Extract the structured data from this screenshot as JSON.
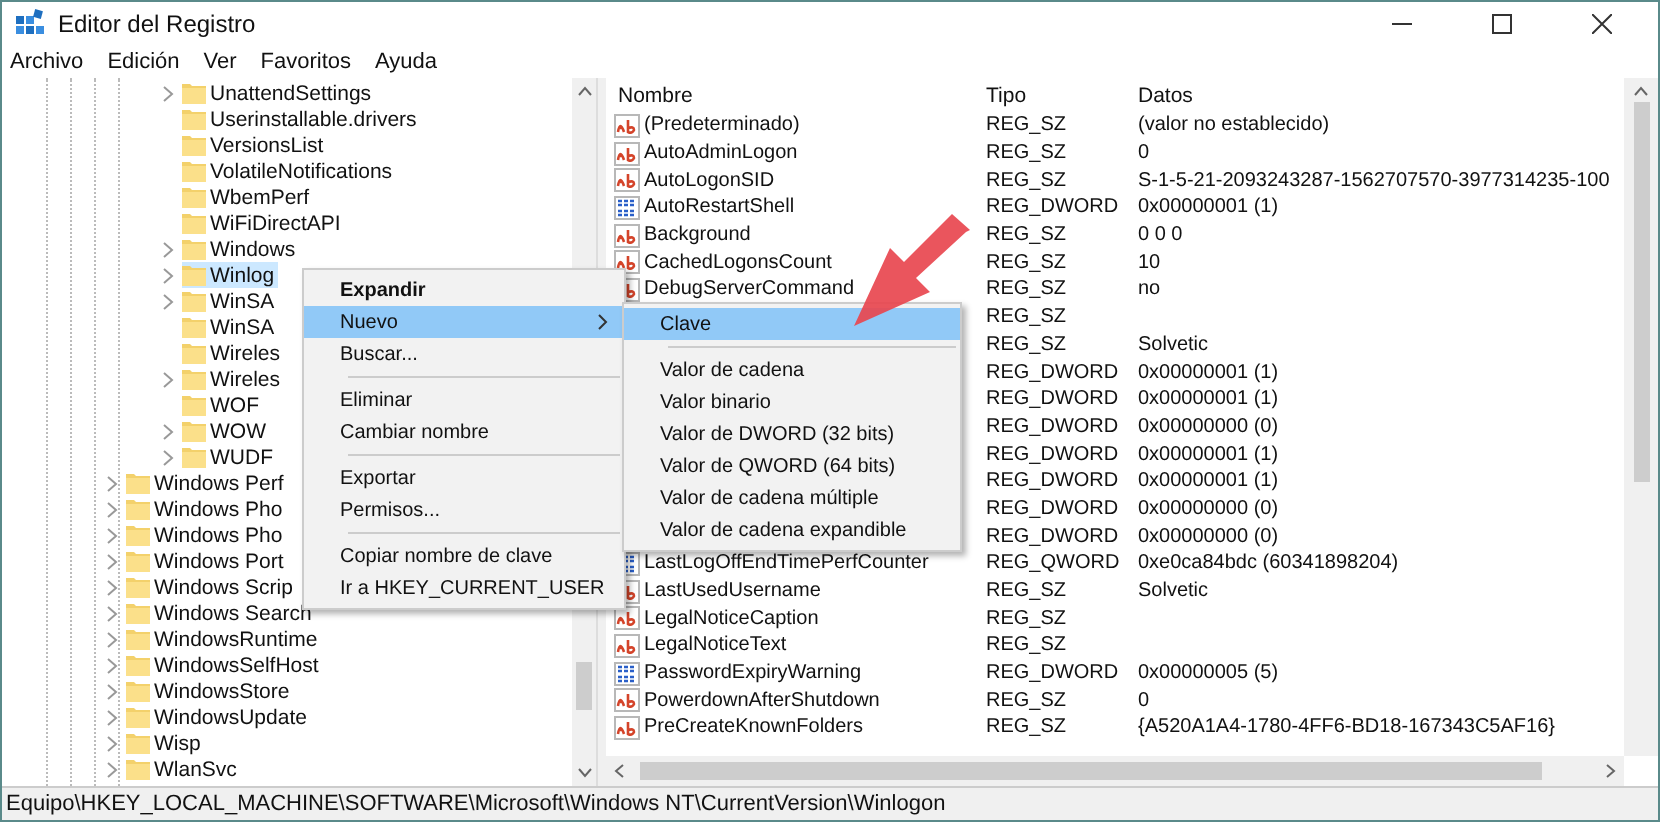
{
  "window": {
    "title": "Editor del Registro"
  },
  "menu": [
    "Archivo",
    "Edición",
    "Ver",
    "Favoritos",
    "Ayuda"
  ],
  "tree": {
    "items": [
      {
        "children": [
          {
            "label": "UnattendSettings",
            "expandable": true,
            "selected": false
          },
          {
            "label": "Userinstallable.drivers",
            "expandable": false,
            "selected": false
          },
          {
            "label": "VersionsList",
            "expandable": false,
            "selected": false
          },
          {
            "label": "VolatileNotifications",
            "expandable": false,
            "selected": false
          },
          {
            "label": "WbemPerf",
            "expandable": false,
            "selected": false
          },
          {
            "label": "WiFiDirectAPI",
            "expandable": false,
            "selected": false
          },
          {
            "label": "Windows",
            "expandable": true,
            "selected": false
          },
          {
            "label": "Winlog",
            "expandable": true,
            "selected": true
          },
          {
            "label": "WinSA",
            "expandable": true,
            "selected": false
          },
          {
            "label": "WinSA",
            "expandable": false,
            "selected": false
          },
          {
            "label": "Wireles",
            "expandable": false,
            "selected": false
          },
          {
            "label": "Wireles",
            "expandable": true,
            "selected": false
          },
          {
            "label": "WOF",
            "expandable": false,
            "selected": false
          },
          {
            "label": "WOW",
            "expandable": true,
            "selected": false
          },
          {
            "label": "WUDF",
            "expandable": true,
            "selected": false
          }
        ]
      },
      {
        "label": "Windows Perf",
        "expandable": true,
        "selected": false
      },
      {
        "label": "Windows Pho",
        "expandable": true,
        "selected": false
      },
      {
        "label": "Windows Pho",
        "expandable": true,
        "selected": false
      },
      {
        "label": "Windows Port",
        "expandable": true,
        "selected": false
      },
      {
        "label": "Windows Scrip",
        "expandable": true,
        "selected": false
      },
      {
        "label": "Windows Search",
        "expandable": true,
        "selected": false
      },
      {
        "label": "WindowsRuntime",
        "expandable": true,
        "selected": false
      },
      {
        "label": "WindowsSelfHost",
        "expandable": true,
        "selected": false
      },
      {
        "label": "WindowsStore",
        "expandable": true,
        "selected": false
      },
      {
        "label": "WindowsUpdate",
        "expandable": true,
        "selected": false
      },
      {
        "label": "Wisp",
        "expandable": true,
        "selected": false
      },
      {
        "label": "WlanSvc",
        "expandable": true,
        "selected": false
      }
    ]
  },
  "values": {
    "columns": [
      "Nombre",
      "Tipo",
      "Datos"
    ],
    "rows": [
      {
        "kind": "string",
        "name": "(Predeterminado)",
        "type": "REG_SZ",
        "data": "(valor no establecido)"
      },
      {
        "kind": "string",
        "name": "AutoAdminLogon",
        "type": "REG_SZ",
        "data": "0"
      },
      {
        "kind": "string",
        "name": "AutoLogonSID",
        "type": "REG_SZ",
        "data": "S-1-5-21-2093243287-1562707570-3977314235-100"
      },
      {
        "kind": "binary",
        "name": "AutoRestartShell",
        "type": "REG_DWORD",
        "data": "0x00000001 (1)"
      },
      {
        "kind": "string",
        "name": "Background",
        "type": "REG_SZ",
        "data": "0 0 0"
      },
      {
        "kind": "string",
        "name": "CachedLogonsCount",
        "type": "REG_SZ",
        "data": "10"
      },
      {
        "kind": "string",
        "name": "DebugServerCommand",
        "type": "REG_SZ",
        "data": "no"
      },
      {
        "type": "REG_SZ"
      },
      {
        "type": "REG_SZ",
        "data": "Solvetic"
      },
      {
        "type": "REG_DWORD",
        "data": "0x00000001 (1)"
      },
      {
        "type": "REG_DWORD",
        "data": "0x00000001 (1)"
      },
      {
        "type": "REG_DWORD",
        "data": "0x00000000 (0)"
      },
      {
        "type": "REG_DWORD",
        "data": "0x00000001 (1)"
      },
      {
        "type": "REG_DWORD",
        "data": "0x00000001 (1)"
      },
      {
        "type": "REG_DWORD",
        "data": "0x00000000 (0)"
      },
      {
        "type": "REG_DWORD",
        "data": "0x00000000 (0)"
      },
      {
        "kind": "binary",
        "name": "LastLogOffEndTimePerfCounter",
        "type": "REG_QWORD",
        "data": "0xe0ca84bdc (60341898204)"
      },
      {
        "kind": "string",
        "name": "LastUsedUsername",
        "type": "REG_SZ",
        "data": "Solvetic"
      },
      {
        "kind": "string",
        "name": "LegalNoticeCaption",
        "type": "REG_SZ"
      },
      {
        "kind": "string",
        "name": "LegalNoticeText",
        "type": "REG_SZ"
      },
      {
        "kind": "binary",
        "name": "PasswordExpiryWarning",
        "type": "REG_DWORD",
        "data": "0x00000005 (5)"
      },
      {
        "kind": "string",
        "name": "PowerdownAfterShutdown",
        "type": "REG_SZ",
        "data": "0"
      },
      {
        "kind": "string",
        "name": "PreCreateKnownFolders",
        "type": "REG_SZ",
        "data": "{A520A1A4-1780-4FF6-BD18-167343C5AF16}"
      }
    ]
  },
  "context_menu": {
    "items": [
      {
        "kind": "item",
        "label": "Expandir",
        "default": true,
        "selected": false,
        "has_submenu": false
      },
      {
        "kind": "item",
        "label": "Nuevo",
        "default": false,
        "selected": true,
        "has_submenu": true
      },
      {
        "kind": "item",
        "label": "Buscar...",
        "default": false,
        "selected": false,
        "has_submenu": false
      },
      {
        "kind": "separator"
      },
      {
        "kind": "item",
        "label": "Eliminar",
        "default": false,
        "selected": false,
        "has_submenu": false
      },
      {
        "kind": "item",
        "label": "Cambiar nombre",
        "default": false,
        "selected": false,
        "has_submenu": false
      },
      {
        "kind": "separator"
      },
      {
        "kind": "item",
        "label": "Exportar",
        "default": false,
        "selected": false,
        "has_submenu": false
      },
      {
        "kind": "item",
        "label": "Permisos...",
        "default": false,
        "selected": false,
        "has_submenu": false
      },
      {
        "kind": "separator"
      },
      {
        "kind": "item",
        "label": "Copiar nombre de clave",
        "default": false,
        "selected": false,
        "has_submenu": false
      },
      {
        "kind": "item",
        "label": "Ir a HKEY_CURRENT_USER",
        "default": false,
        "selected": false,
        "has_submenu": false
      }
    ]
  },
  "submenu": {
    "items": [
      {
        "kind": "item",
        "label": "Clave",
        "selected": true
      },
      {
        "kind": "separator"
      },
      {
        "kind": "item",
        "label": "Valor de cadena",
        "selected": false
      },
      {
        "kind": "item",
        "label": "Valor binario",
        "selected": false
      },
      {
        "kind": "item",
        "label": "Valor de DWORD (32 bits)",
        "selected": false
      },
      {
        "kind": "item",
        "label": "Valor de QWORD (64 bits)",
        "selected": false
      },
      {
        "kind": "item",
        "label": "Valor de cadena múltiple",
        "selected": false
      },
      {
        "kind": "item",
        "label": "Valor de cadena expandible",
        "selected": false
      }
    ]
  },
  "status_bar": "Equipo\\HKEY_LOCAL_MACHINE\\SOFTWARE\\Microsoft\\Windows NT\\CurrentVersion\\Winlogon"
}
